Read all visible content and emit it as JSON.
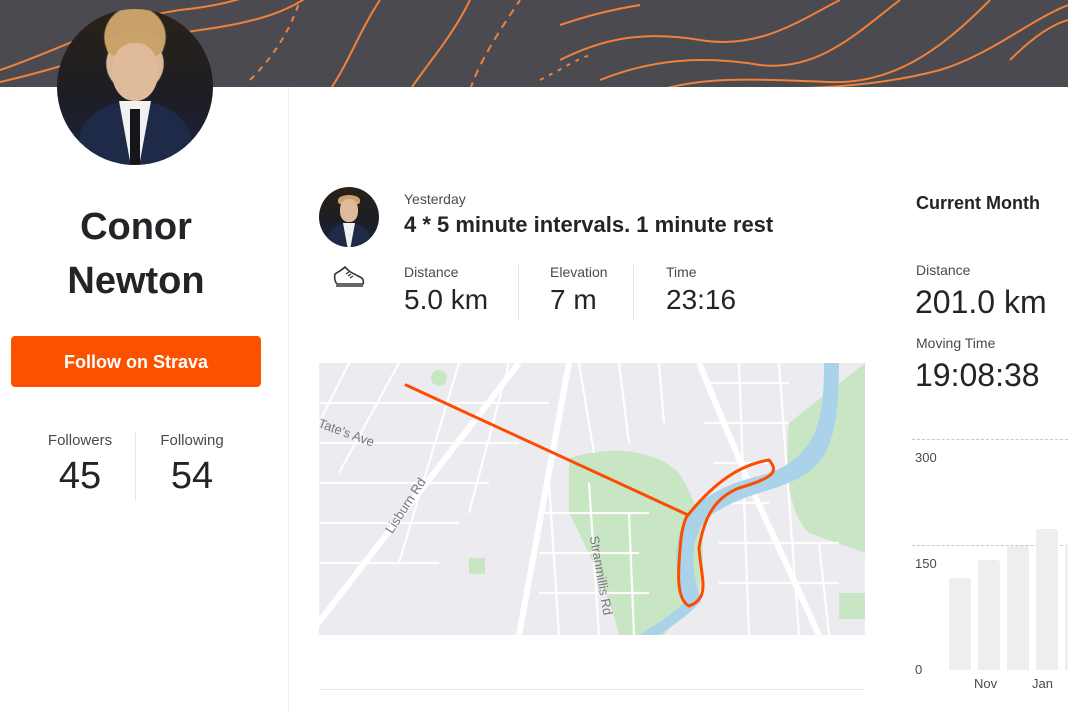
{
  "profile": {
    "name_first": "Conor",
    "name_last": "Newton",
    "follow_label": "Follow on Strava",
    "followers_label": "Followers",
    "followers_value": "45",
    "following_label": "Following",
    "following_value": "54"
  },
  "activity": {
    "when": "Yesterday",
    "title": "4 * 5 minute intervals. 1 minute rest",
    "icon": "running-shoe-icon",
    "metrics": [
      {
        "label": "Distance",
        "value": "5.0 km"
      },
      {
        "label": "Elevation",
        "value": "7 m"
      },
      {
        "label": "Time",
        "value": "23:16"
      }
    ],
    "map_labels": {
      "street1": "Tate's Ave",
      "street2": "Lisburn Rd",
      "street3": "Stranmillis Rd"
    }
  },
  "month": {
    "title": "Current Month",
    "distance_label": "Distance",
    "distance_value": "201.0 km",
    "moving_label": "Moving Time",
    "moving_value": "19:08:38"
  },
  "chart_data": {
    "type": "bar",
    "categories": [
      "",
      "Nov",
      "",
      "Jan",
      ""
    ],
    "values": [
      130,
      155,
      175,
      200,
      180
    ],
    "ylim": [
      0,
      300
    ],
    "yticks": [
      "0",
      "150",
      "300"
    ],
    "xlabels": [
      "Nov",
      "Jan"
    ],
    "grid": true
  },
  "colors": {
    "brand": "#fc5200",
    "banner": "#4a4a50",
    "route": "#fc4c02",
    "water": "#aad3ea",
    "park": "#c8e6c3"
  }
}
